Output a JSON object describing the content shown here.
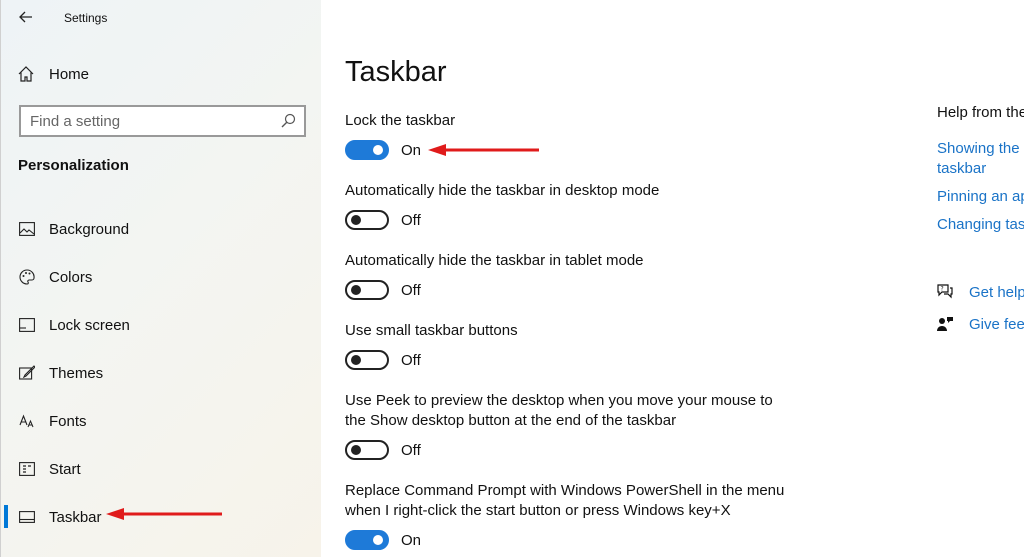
{
  "window": {
    "title": "Settings"
  },
  "sidebar": {
    "home_label": "Home",
    "search_placeholder": "Find a setting",
    "section_heading": "Personalization",
    "items": [
      {
        "label": "Background",
        "icon": "picture-icon"
      },
      {
        "label": "Colors",
        "icon": "palette-icon"
      },
      {
        "label": "Lock screen",
        "icon": "lock-screen-icon"
      },
      {
        "label": "Themes",
        "icon": "themes-icon"
      },
      {
        "label": "Fonts",
        "icon": "fonts-icon"
      },
      {
        "label": "Start",
        "icon": "start-icon"
      },
      {
        "label": "Taskbar",
        "icon": "taskbar-icon",
        "selected": true
      }
    ]
  },
  "main": {
    "title": "Taskbar",
    "settings": [
      {
        "label": "Lock the taskbar",
        "state": "On",
        "on": true
      },
      {
        "label": "Automatically hide the taskbar in desktop mode",
        "state": "Off",
        "on": false
      },
      {
        "label": "Automatically hide the taskbar in tablet mode",
        "state": "Off",
        "on": false
      },
      {
        "label": "Use small taskbar buttons",
        "state": "Off",
        "on": false
      },
      {
        "label_line1": "Use Peek to preview the desktop when you move your mouse to",
        "label_line2": "the Show desktop button at the end of the taskbar",
        "state": "Off",
        "on": false
      },
      {
        "label_line1": "Replace Command Prompt with Windows PowerShell in the menu",
        "label_line2": "when I right-click the start button or press Windows key+X",
        "state": "On",
        "on": true
      }
    ]
  },
  "help": {
    "title": "Help from the",
    "links": [
      "Showing the",
      "taskbar",
      "Pinning an ap",
      "Changing tas"
    ],
    "get_help": "Get help",
    "give_feedback": "Give fee"
  },
  "colors": {
    "accent": "#0078d7",
    "toggle_on": "#1e7ad8",
    "link": "#1a73c7",
    "annotation_arrow": "#e01b1b"
  }
}
